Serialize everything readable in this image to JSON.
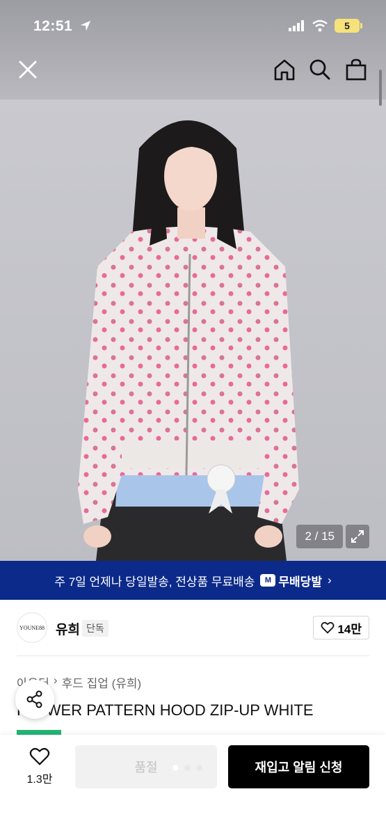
{
  "status_bar": {
    "time": "12:51",
    "battery": "5"
  },
  "nav": {
    "close_icon": "close-icon",
    "home_icon": "home-icon",
    "search_icon": "search-icon",
    "bag_icon": "shopping-bag-icon"
  },
  "gallery": {
    "counter": "2 / 15",
    "expand_icon": "expand-icon"
  },
  "banner": {
    "text": "주 7일 언제나 당일발송, 전상품 무료배송",
    "logo_badge": "M",
    "logo_text": "무배당발",
    "chevron": "›"
  },
  "brand": {
    "logo_text": "YOUNE88",
    "name": "유희",
    "badge": "단독",
    "likes": "14만"
  },
  "breadcrumb": {
    "category": "아우터",
    "separator": "›",
    "subcategory": "후드 집업 (유희)"
  },
  "product": {
    "title": "FLOWER PATTERN HOOD ZIP-UP WHITE"
  },
  "colors": {
    "banner": "#0c2a8a",
    "accent_green": "#22b573",
    "cta": "#000000"
  },
  "bottom_bar": {
    "fav_count": "1.3만",
    "soldout_label": "품절",
    "restock_label": "재입고 알림 신청"
  }
}
